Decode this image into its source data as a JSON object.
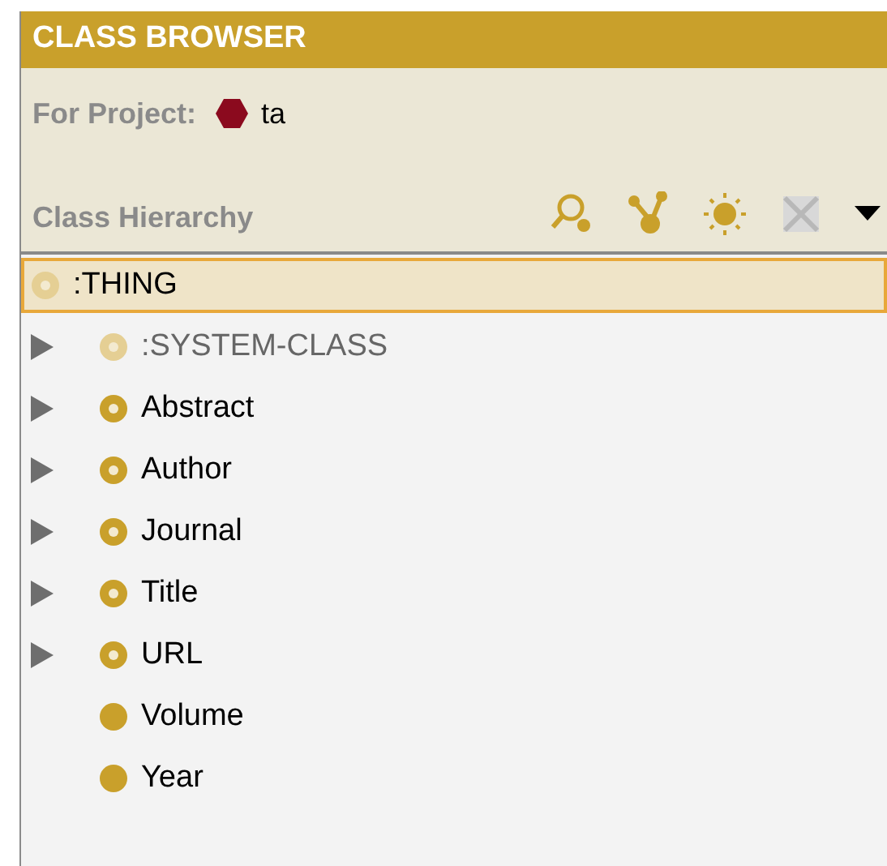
{
  "header": {
    "title": "CLASS BROWSER"
  },
  "project": {
    "label": "For Project:",
    "name": "ta"
  },
  "hierarchy": {
    "title": "Class Hierarchy"
  },
  "tree": [
    {
      "label": ":THING",
      "kind": "system",
      "selected": true,
      "children": [
        {
          "label": ":SYSTEM-CLASS",
          "kind": "system",
          "expandable": true,
          "selected": false
        },
        {
          "label": "Abstract",
          "kind": "abstract",
          "expandable": true,
          "selected": false
        },
        {
          "label": "Author",
          "kind": "abstract",
          "expandable": true,
          "selected": false
        },
        {
          "label": "Journal",
          "kind": "abstract",
          "expandable": true,
          "selected": false
        },
        {
          "label": "Title",
          "kind": "abstract",
          "expandable": true,
          "selected": false
        },
        {
          "label": "URL",
          "kind": "abstract",
          "expandable": true,
          "selected": false
        },
        {
          "label": "Volume",
          "kind": "concrete",
          "expandable": false,
          "selected": false
        },
        {
          "label": "Year",
          "kind": "concrete",
          "expandable": false,
          "selected": false
        }
      ]
    }
  ]
}
